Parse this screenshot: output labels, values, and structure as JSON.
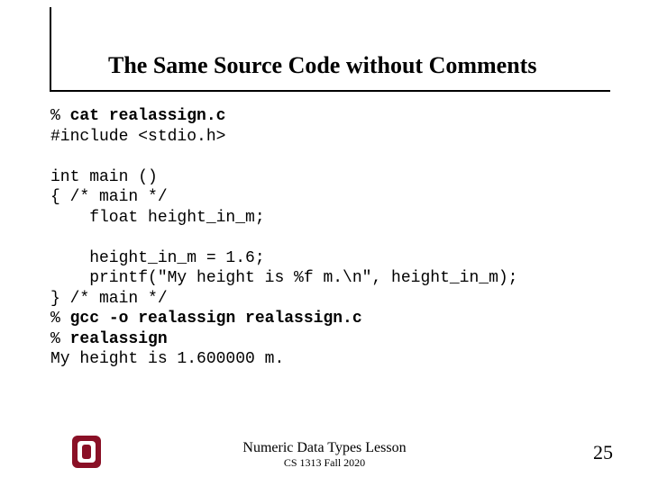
{
  "title": "The Same Source Code without Comments",
  "code": {
    "lines": [
      {
        "pre": "% ",
        "bold": "cat realassign.c",
        "post": ""
      },
      {
        "pre": "#include <stdio.h>",
        "bold": "",
        "post": ""
      },
      {
        "pre": "",
        "bold": "",
        "post": ""
      },
      {
        "pre": "int main ()",
        "bold": "",
        "post": ""
      },
      {
        "pre": "{ /* main */",
        "bold": "",
        "post": ""
      },
      {
        "pre": "    float height_in_m;",
        "bold": "",
        "post": ""
      },
      {
        "pre": "",
        "bold": "",
        "post": ""
      },
      {
        "pre": "    height_in_m = 1.6;",
        "bold": "",
        "post": ""
      },
      {
        "pre": "    printf(\"My height is %f m.\\n\", height_in_m);",
        "bold": "",
        "post": ""
      },
      {
        "pre": "} /* main */",
        "bold": "",
        "post": ""
      },
      {
        "pre": "% ",
        "bold": "gcc -o realassign realassign.c",
        "post": ""
      },
      {
        "pre": "% ",
        "bold": "realassign",
        "post": ""
      },
      {
        "pre": "My height is 1.600000 m.",
        "bold": "",
        "post": ""
      }
    ]
  },
  "footer": {
    "line1": "Numeric Data Types Lesson",
    "line2": "CS 1313 Fall 2020"
  },
  "page_number": "25",
  "logo_name": "ou-logo"
}
